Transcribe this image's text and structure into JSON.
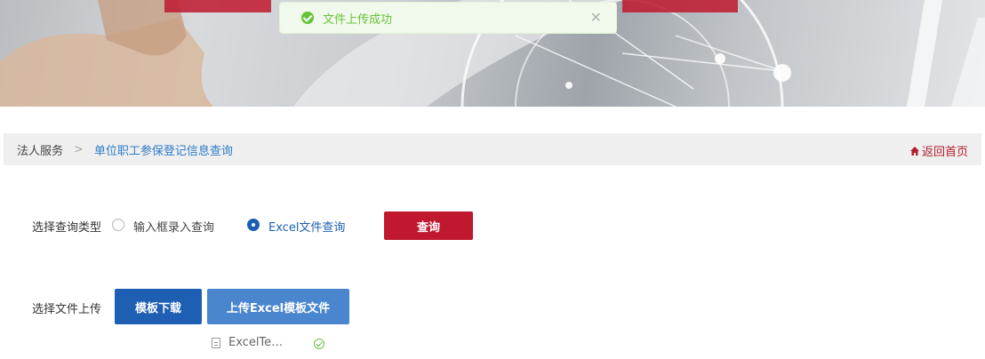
{
  "toast": {
    "message": "文件上传成功"
  },
  "breadcrumb": {
    "root": "法人服务",
    "current": "单位职工参保登记信息查询",
    "home_link": "返回首页"
  },
  "query_type": {
    "label": "选择查询类型",
    "options": [
      "输入框录入查询",
      "Excel文件查询"
    ],
    "selected": "Excel文件查询",
    "submit_label": "查询"
  },
  "upload": {
    "label": "选择文件上传",
    "template_button": "模板下载",
    "upload_button": "上传Excel模板文件",
    "files": [
      {
        "name": "ExcelTe…",
        "status": "success"
      }
    ]
  },
  "colors": {
    "primary_red": "#c0182e",
    "primary_blue": "#1e5fb3",
    "success_green": "#67c23a"
  }
}
